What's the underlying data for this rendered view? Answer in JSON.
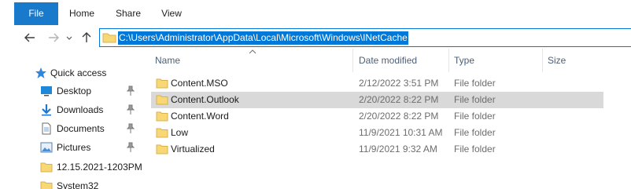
{
  "ribbon": {
    "tabs": [
      {
        "label": "File"
      },
      {
        "label": "Home"
      },
      {
        "label": "Share"
      },
      {
        "label": "View"
      }
    ]
  },
  "address": {
    "path": "C:\\Users\\Administrator\\AppData\\Local\\Microsoft\\Windows\\INetCache",
    "folder_icon": "folder-icon"
  },
  "nav_buttons": {
    "back": "back-arrow-icon",
    "forward": "forward-arrow-icon",
    "recent": "chevron-down-icon",
    "up": "up-arrow-icon"
  },
  "navigation_pane": {
    "items": [
      {
        "label": "Quick access",
        "icon": "star-icon"
      },
      {
        "label": "Desktop",
        "icon": "desktop-icon",
        "pinned": true
      },
      {
        "label": "Downloads",
        "icon": "download-icon",
        "pinned": true
      },
      {
        "label": "Documents",
        "icon": "documents-icon",
        "pinned": true
      },
      {
        "label": "Pictures",
        "icon": "pictures-icon",
        "pinned": true
      },
      {
        "label": "12.15.2021-1203PM",
        "icon": "folder-icon"
      },
      {
        "label": "System32",
        "icon": "folder-icon"
      }
    ]
  },
  "columns": {
    "name": "Name",
    "date_modified": "Date modified",
    "type": "Type",
    "size": "Size"
  },
  "files": [
    {
      "name": "Content.MSO",
      "date": "2/12/2022 3:51 PM",
      "type": "File folder",
      "selected": false
    },
    {
      "name": "Content.Outlook",
      "date": "2/20/2022 8:22 PM",
      "type": "File folder",
      "selected": true
    },
    {
      "name": "Content.Word",
      "date": "2/20/2022 8:22 PM",
      "type": "File folder",
      "selected": false
    },
    {
      "name": "Low",
      "date": "11/9/2021 10:31 AM",
      "type": "File folder",
      "selected": false
    },
    {
      "name": "Virtualized",
      "date": "11/9/2021 9:32 AM",
      "type": "File folder",
      "selected": false
    }
  ],
  "colors": {
    "file_tab": "#1979ca",
    "selection": "#0078d7",
    "folder": "#f8d775",
    "row_highlight": "#d9d9d9"
  }
}
